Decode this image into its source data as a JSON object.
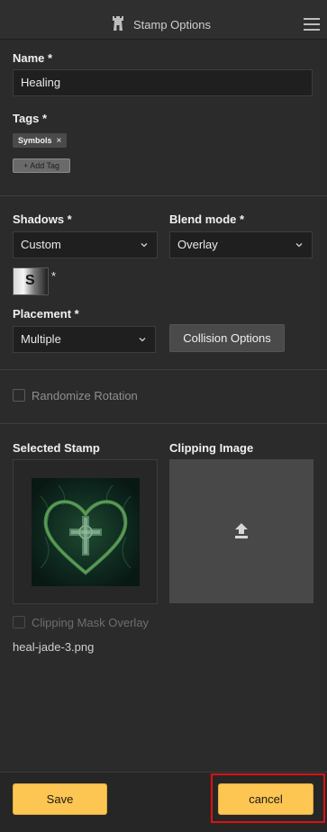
{
  "header": {
    "title": "Stamp Options"
  },
  "name": {
    "label": "Name *",
    "value": "Healing"
  },
  "tags": {
    "label": "Tags *",
    "items": [
      {
        "text": "Symbols",
        "remove": "×"
      }
    ],
    "add_label": "+ Add Tag"
  },
  "shadows": {
    "label": "Shadows *",
    "selected": "Custom",
    "preview_letter": "S",
    "required_mark": "*"
  },
  "blend_mode": {
    "label": "Blend mode *",
    "selected": "Overlay"
  },
  "placement": {
    "label": "Placement *",
    "selected": "Multiple"
  },
  "collision_button": "Collision Options",
  "randomize_rotation": {
    "label": "Randomize Rotation",
    "checked": false
  },
  "selected_stamp": {
    "label": "Selected Stamp",
    "filename": "heal-jade-3.png"
  },
  "clipping_image": {
    "label": "Clipping Image"
  },
  "clipping_mask_overlay": {
    "label": "Clipping Mask Overlay",
    "checked": false,
    "disabled": true
  },
  "footer": {
    "save": "Save",
    "cancel": "cancel"
  },
  "colors": {
    "accent": "#fdc552",
    "background": "#2b2b2b",
    "field": "#1f1f1f",
    "highlight": "#e01010"
  },
  "icons": {
    "header": "castle-tower-icon",
    "menu": "hamburger-menu-icon",
    "upload": "upload-icon"
  }
}
